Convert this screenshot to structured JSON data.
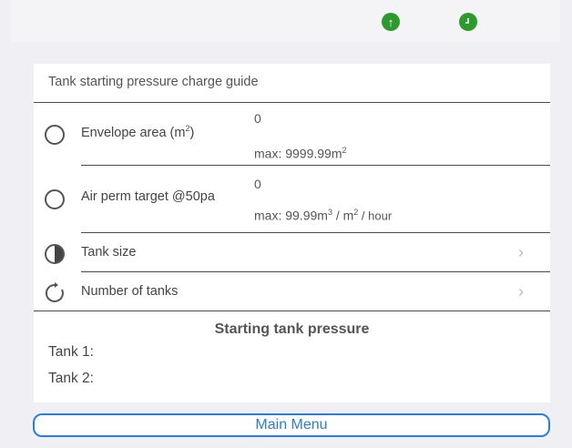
{
  "status": {
    "left_icon": "arrow-up-circle-icon",
    "right_icon": "clock-icon",
    "color": "#2e9a2e"
  },
  "card": {
    "title": "Tank starting pressure charge guide",
    "envelope": {
      "label": "Envelope area (m",
      "label_sup": "2",
      "label_end": ")",
      "value": "0",
      "max": "max: 9999.99m",
      "max_sup": "2"
    },
    "air_perm": {
      "label": "Air perm target @50pa",
      "value": "0",
      "max": "max: 99.99m",
      "max_sup": "3",
      "max_mid": " / m",
      "max_sup2": "2",
      "max_end": " / hour"
    },
    "tank_size": {
      "label": "Tank size"
    },
    "num_tanks": {
      "label": "Number of tanks"
    },
    "section_title": "Starting tank pressure",
    "tank1": "Tank 1:",
    "tank2": "Tank 2:"
  },
  "main_menu": "Main Menu",
  "colors": {
    "accent": "#2a7de1"
  }
}
